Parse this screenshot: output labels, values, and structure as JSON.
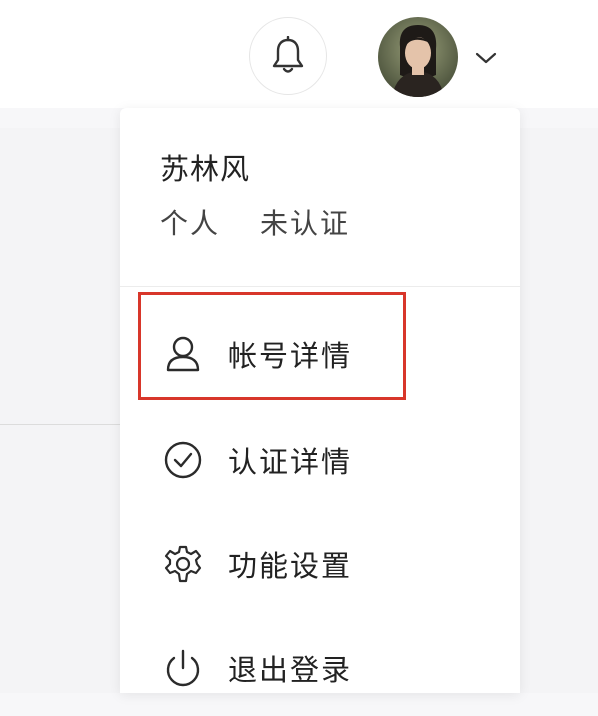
{
  "header": {
    "notification_icon": "bell-icon",
    "avatar_icon": "user-avatar",
    "dropdown_icon": "chevron-down-icon"
  },
  "user_menu": {
    "name": "苏林风",
    "account_type": "个人",
    "verification_status": "未认证",
    "items": [
      {
        "label": "帐号详情",
        "icon": "user-icon"
      },
      {
        "label": "认证详情",
        "icon": "check-circle-icon"
      },
      {
        "label": "功能设置",
        "icon": "gear-icon"
      },
      {
        "label": "退出登录",
        "icon": "power-icon"
      }
    ]
  },
  "colors": {
    "highlight": "#d8362a"
  }
}
